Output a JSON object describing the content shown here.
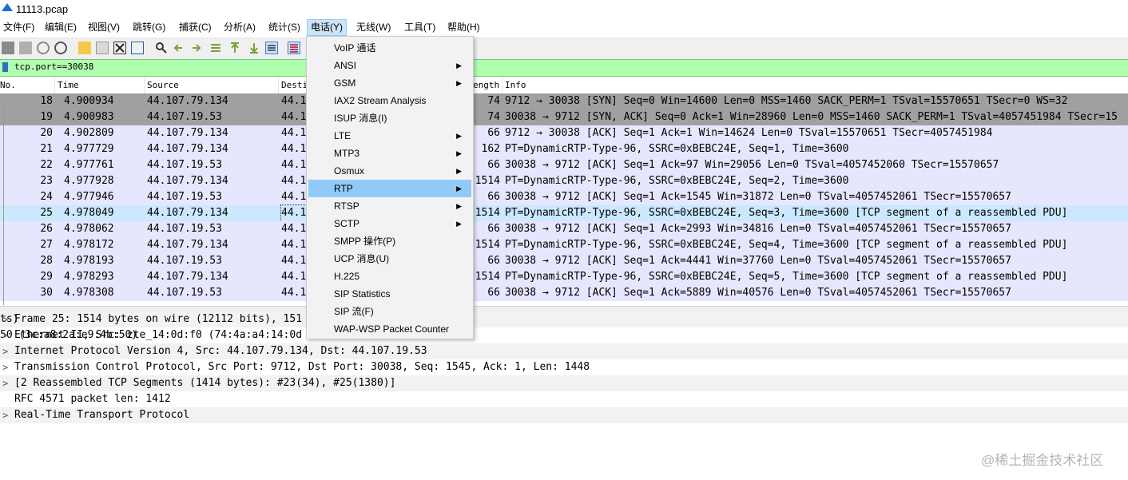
{
  "window": {
    "title": "11113.pcap"
  },
  "menubar": [
    "文件(F)",
    "编辑(E)",
    "视图(V)",
    "跳转(G)",
    "捕获(C)",
    "分析(A)",
    "统计(S)",
    "电话(Y)",
    "无线(W)",
    "工具(T)",
    "帮助(H)"
  ],
  "filter": {
    "value": "tcp.port==30038"
  },
  "packet_list": {
    "columns": [
      "No.",
      "Time",
      "Source",
      "Desti",
      "ength",
      "Info"
    ],
    "rows": [
      {
        "no": "18",
        "time": "4.900934",
        "src": "44.107.79.134",
        "dst": "44.1",
        "len": "74",
        "info": "9712 → 30038 [SYN] Seq=0 Win=14600 Len=0 MSS=1460 SACK_PERM=1 TSval=15570651 TSecr=0 WS=32"
      },
      {
        "no": "19",
        "time": "4.900983",
        "src": "44.107.19.53",
        "dst": "44.1",
        "len": "74",
        "info": "30038 → 9712 [SYN, ACK] Seq=0 Ack=1 Win=28960 Len=0 MSS=1460 SACK_PERM=1 TSval=4057451984 TSecr=15"
      },
      {
        "no": "20",
        "time": "4.902809",
        "src": "44.107.79.134",
        "dst": "44.1",
        "len": "66",
        "info": "9712 → 30038 [ACK] Seq=1 Ack=1 Win=14624 Len=0 TSval=15570651 TSecr=4057451984"
      },
      {
        "no": "21",
        "time": "4.977729",
        "src": "44.107.79.134",
        "dst": "44.1",
        "len": "162",
        "info": "PT=DynamicRTP-Type-96, SSRC=0xBEBC24E, Seq=1, Time=3600"
      },
      {
        "no": "22",
        "time": "4.977761",
        "src": "44.107.19.53",
        "dst": "44.1",
        "len": "66",
        "info": "30038 → 9712 [ACK] Seq=1 Ack=97 Win=29056 Len=0 TSval=4057452060 TSecr=15570657"
      },
      {
        "no": "23",
        "time": "4.977928",
        "src": "44.107.79.134",
        "dst": "44.1",
        "len": "1514",
        "info": "PT=DynamicRTP-Type-96, SSRC=0xBEBC24E, Seq=2, Time=3600"
      },
      {
        "no": "24",
        "time": "4.977946",
        "src": "44.107.19.53",
        "dst": "44.1",
        "len": "66",
        "info": "30038 → 9712 [ACK] Seq=1 Ack=1545 Win=31872 Len=0 TSval=4057452061 TSecr=15570657"
      },
      {
        "no": "25",
        "time": "4.978049",
        "src": "44.107.79.134",
        "dst": "44.1",
        "len": "1514",
        "info": "PT=DynamicRTP-Type-96, SSRC=0xBEBC24E, Seq=3, Time=3600 [TCP segment of a reassembled PDU]"
      },
      {
        "no": "26",
        "time": "4.978062",
        "src": "44.107.19.53",
        "dst": "44.1",
        "len": "66",
        "info": "30038 → 9712 [ACK] Seq=1 Ack=2993 Win=34816 Len=0 TSval=4057452061 TSecr=15570657"
      },
      {
        "no": "27",
        "time": "4.978172",
        "src": "44.107.79.134",
        "dst": "44.1",
        "len": "1514",
        "info": "PT=DynamicRTP-Type-96, SSRC=0xBEBC24E, Seq=4, Time=3600 [TCP segment of a reassembled PDU]"
      },
      {
        "no": "28",
        "time": "4.978193",
        "src": "44.107.19.53",
        "dst": "44.1",
        "len": "66",
        "info": "30038 → 9712 [ACK] Seq=1 Ack=4441 Win=37760 Len=0 TSval=4057452061 TSecr=15570657"
      },
      {
        "no": "29",
        "time": "4.978293",
        "src": "44.107.79.134",
        "dst": "44.1",
        "len": "1514",
        "info": "PT=DynamicRTP-Type-96, SSRC=0xBEBC24E, Seq=5, Time=3600 [TCP segment of a reassembled PDU]"
      },
      {
        "no": "30",
        "time": "4.978308",
        "src": "44.107.19.53",
        "dst": "44.1",
        "len": "66",
        "info": "30038 → 9712 [ACK] Seq=1 Ack=5889 Win=40576 Len=0 TSval=4057452061 TSecr=15570657"
      }
    ]
  },
  "details": [
    {
      "text": "Frame 25: 1514 bytes on wire (12112 bits), 151",
      "tail": "ts)",
      "expandable": true
    },
    {
      "text": "Ethernet II, Src: zte_14:0d:f0 (74:4a:a4:14:0d",
      "tail": "50 (3c:a8:2a:e9:4b:50)",
      "expandable": true
    },
    {
      "text": "Internet Protocol Version 4, Src: 44.107.79.134, Dst: 44.107.19.53",
      "tail": "",
      "expandable": true
    },
    {
      "text": "Transmission Control Protocol, Src Port: 9712, Dst Port: 30038, Seq: 1545, Ack: 1, Len: 1448",
      "tail": "",
      "expandable": true
    },
    {
      "text": "[2 Reassembled TCP Segments (1414 bytes): #23(34), #25(1380)]",
      "tail": "",
      "expandable": true
    },
    {
      "text": "RFC 4571 packet len: 1412",
      "tail": "",
      "expandable": false
    },
    {
      "text": "Real-Time Transport Protocol",
      "tail": "",
      "expandable": true
    }
  ],
  "telephony_menu": [
    {
      "label": "VoIP 通话",
      "submenu": false
    },
    {
      "label": "ANSI",
      "submenu": true
    },
    {
      "label": "GSM",
      "submenu": true
    },
    {
      "label": "IAX2 Stream Analysis",
      "submenu": false
    },
    {
      "label": "ISUP 消息(I)",
      "submenu": false
    },
    {
      "label": "LTE",
      "submenu": true
    },
    {
      "label": "MTP3",
      "submenu": true
    },
    {
      "label": "Osmux",
      "submenu": true
    },
    {
      "label": "RTP",
      "submenu": true,
      "highlighted": true
    },
    {
      "label": "RTSP",
      "submenu": true
    },
    {
      "label": "SCTP",
      "submenu": true
    },
    {
      "label": "SMPP 操作(P)",
      "submenu": false
    },
    {
      "label": "UCP 消息(U)",
      "submenu": false
    },
    {
      "label": "H.225",
      "submenu": false
    },
    {
      "label": "SIP Statistics",
      "submenu": false
    },
    {
      "label": "SIP 流(F)",
      "submenu": false
    },
    {
      "label": "WAP-WSP Packet Counter",
      "submenu": false
    }
  ],
  "watermark": "@稀土掘金技术社区",
  "colors": {
    "syn_row": "#a0a0a0",
    "tcp_row": "#e7e6ff",
    "selected_row": "#cce8ff",
    "filter_ok": "#afffaf",
    "menu_highlight": "#91c9f7"
  }
}
